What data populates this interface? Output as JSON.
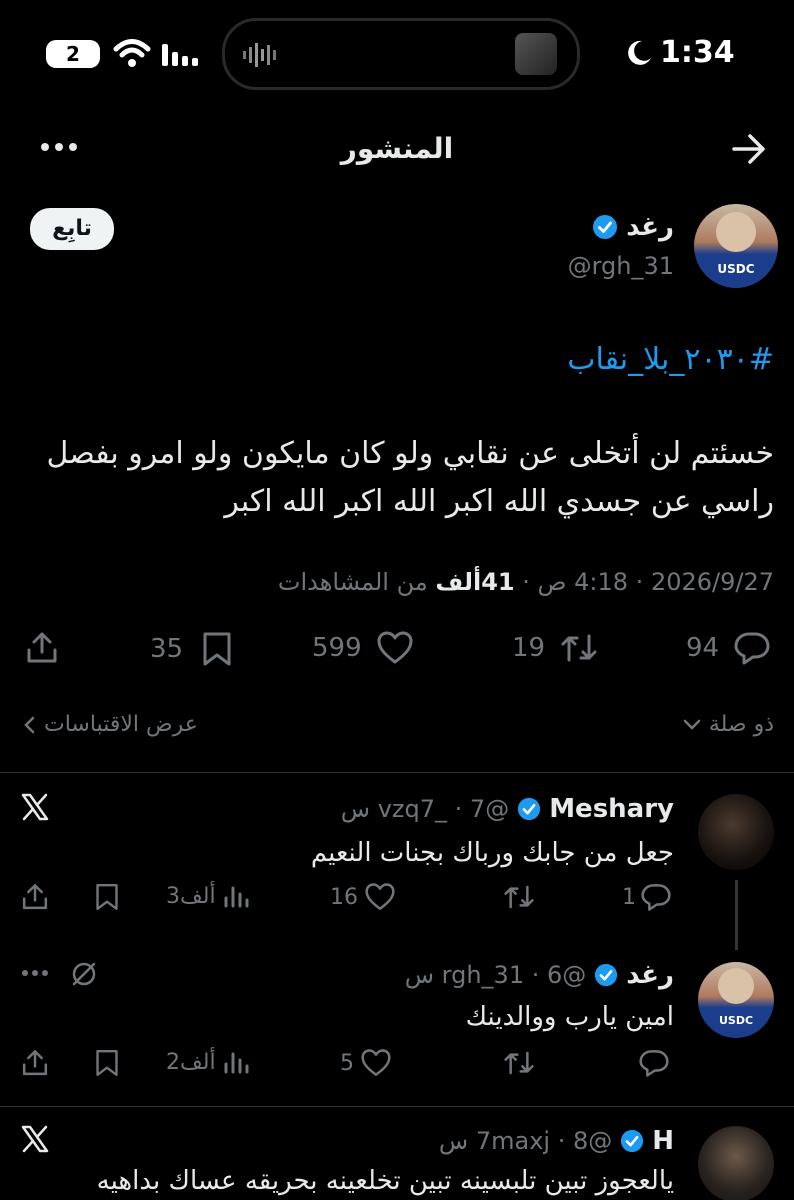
{
  "status_bar": {
    "notification_count": "2",
    "time": "1:34"
  },
  "header": {
    "title": "المنشور"
  },
  "post": {
    "author_name": "رغد",
    "author_handle": "@rgh_31",
    "follow_label": "تابِع",
    "hashtag": "#٢٠٣٠_بلا_نقاب",
    "text_line1": "خسئتم لن أتخلى عن نقابي ولو كان مايكون ولو امرو بفصل",
    "text_line2": "راسي عن جسدي الله اكبر الله اكبر الله اكبر",
    "meta_date": "2026/9/27 · 4:18 ص ·",
    "meta_views_value": "41ألف",
    "meta_views_suffix": "من المشاهدات",
    "stats": {
      "replies": "94",
      "reposts": "19",
      "likes": "599",
      "bookmarks": "35"
    },
    "related_label": "ذو صلة",
    "quotes_label": "عرض الاقتباسات"
  },
  "replies": [
    {
      "name": "Meshary",
      "handle_time": "@vzq7_ · 7 س",
      "text": "جعل من جابك ورباك بجنات النعيم",
      "replies": "1",
      "likes": "16",
      "views": "3ألف"
    },
    {
      "name": "رغد",
      "handle_time": "@rgh_31 · 6 س",
      "text": "امين يارب ووالدينك",
      "replies": "",
      "likes": "5",
      "views": "2ألف"
    },
    {
      "name": "H",
      "handle_time": "@7maxj · 8 س",
      "text": "يالعجوز تبين تلبسينه تبين تخلعينه بحريقه عساك بداهيه"
    }
  ],
  "colors": {
    "accent": "#1d9bf0",
    "text": "#e7e9ea",
    "muted": "#71767b"
  }
}
